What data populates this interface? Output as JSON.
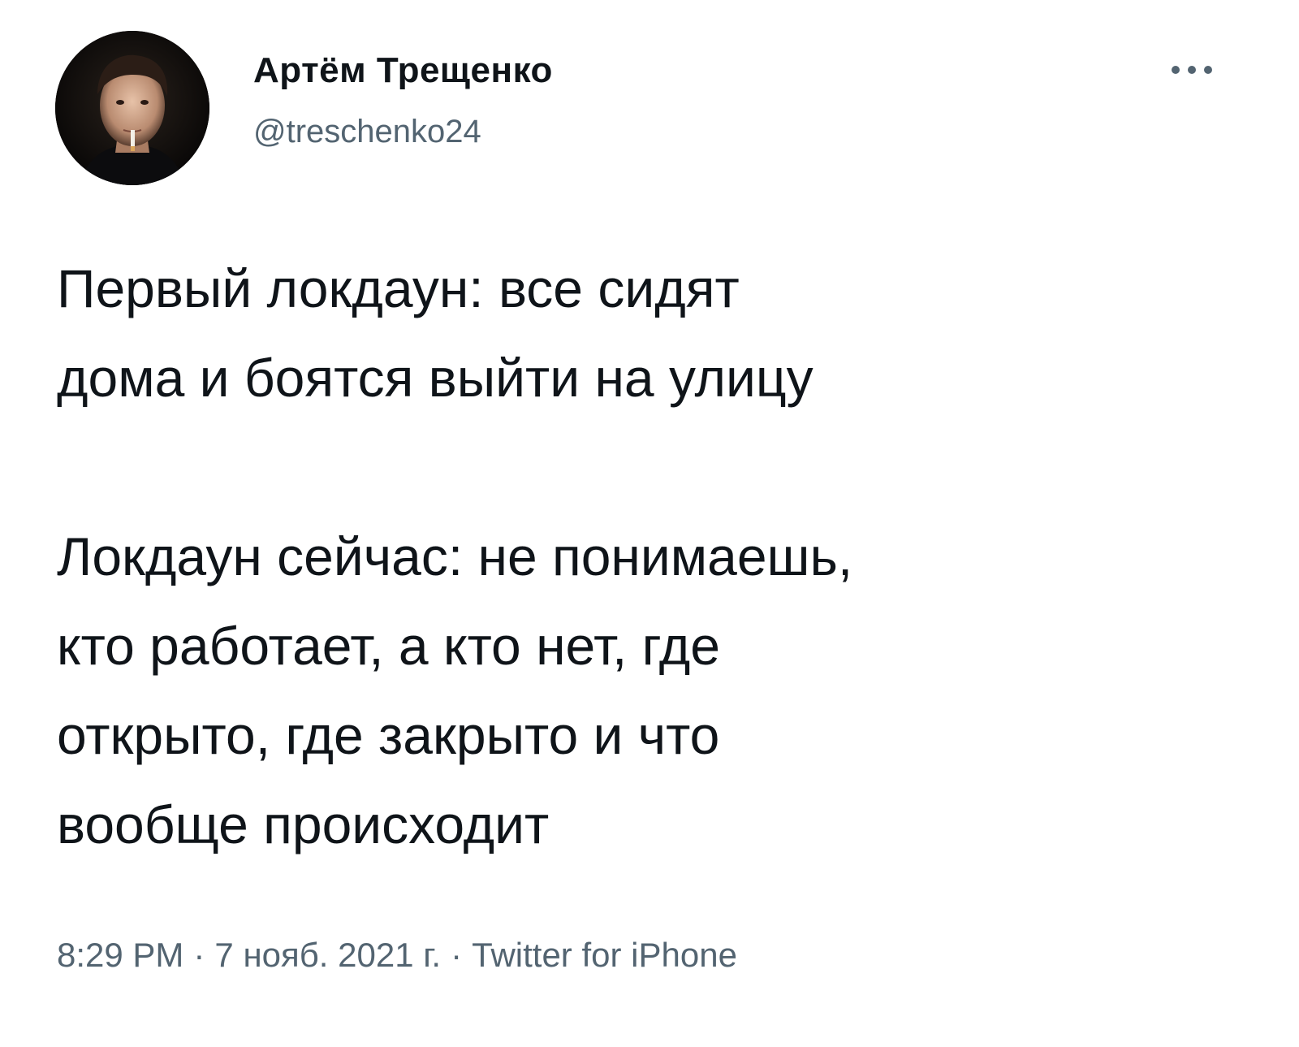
{
  "author": {
    "display_name": "Артём Трещенко",
    "handle": "@treschenko24"
  },
  "more_icon": "more-horizontal-icon",
  "tweet": {
    "paragraph_1_line_1": "Первый локдаун: все сидят",
    "paragraph_1_line_2": "дома и боятся выйти на улицу",
    "paragraph_2_line_1": "Локдаун сейчас: не понимаешь,",
    "paragraph_2_line_2": "кто работает, а кто нет, где",
    "paragraph_2_line_3": "открыто, где закрыто и что",
    "paragraph_2_line_4": "вообще происходит"
  },
  "meta": {
    "time": "8:29 PM",
    "separator": "·",
    "date": "7 нояб. 2021 г.",
    "source": "Twitter for iPhone"
  },
  "colors": {
    "text": "#0f1419",
    "secondary": "#536471",
    "background": "#ffffff"
  }
}
